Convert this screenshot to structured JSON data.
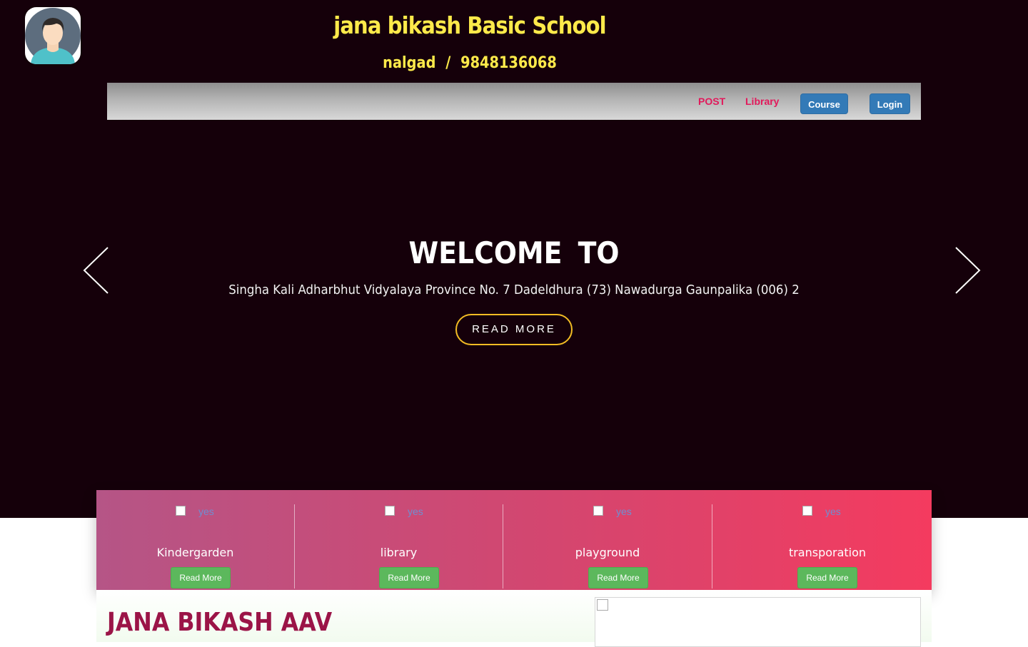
{
  "header": {
    "school_name": "jana bikash Basic School",
    "location": "nalgad",
    "separator": "/",
    "phone": "9848136068"
  },
  "nav": {
    "post": "POST",
    "library": "Library",
    "course": "Course",
    "login": "Login"
  },
  "hero": {
    "heading": "WELCOME  TO",
    "tagline": "Singha Kali Adharbhut Vidyalaya Province No. 7 Dadeldhura (73) Nawadurga Gaunpalika (006) 2",
    "button": "READ MORE"
  },
  "features": [
    {
      "image_alt": "yes",
      "title": "Kindergarden",
      "button": "Read More"
    },
    {
      "image_alt": "yes",
      "title": "library",
      "button": "Read More"
    },
    {
      "image_alt": "yes",
      "title": "playground",
      "button": "Read More"
    },
    {
      "image_alt": "yes",
      "title": "transporation",
      "button": "Read More"
    }
  ],
  "about": {
    "title": "JANA BIKASH AAV"
  },
  "colors": {
    "hero_bg": "#15000a",
    "title_yellow": "#fdea4a",
    "nav_link": "#e2195b",
    "nav_button": "#337ab7",
    "feature_button": "#5cb85c",
    "about_title": "#9b1447"
  },
  "icons": [
    "avatar",
    "prev-arrow-icon",
    "next-arrow-icon",
    "broken-image-icon"
  ]
}
